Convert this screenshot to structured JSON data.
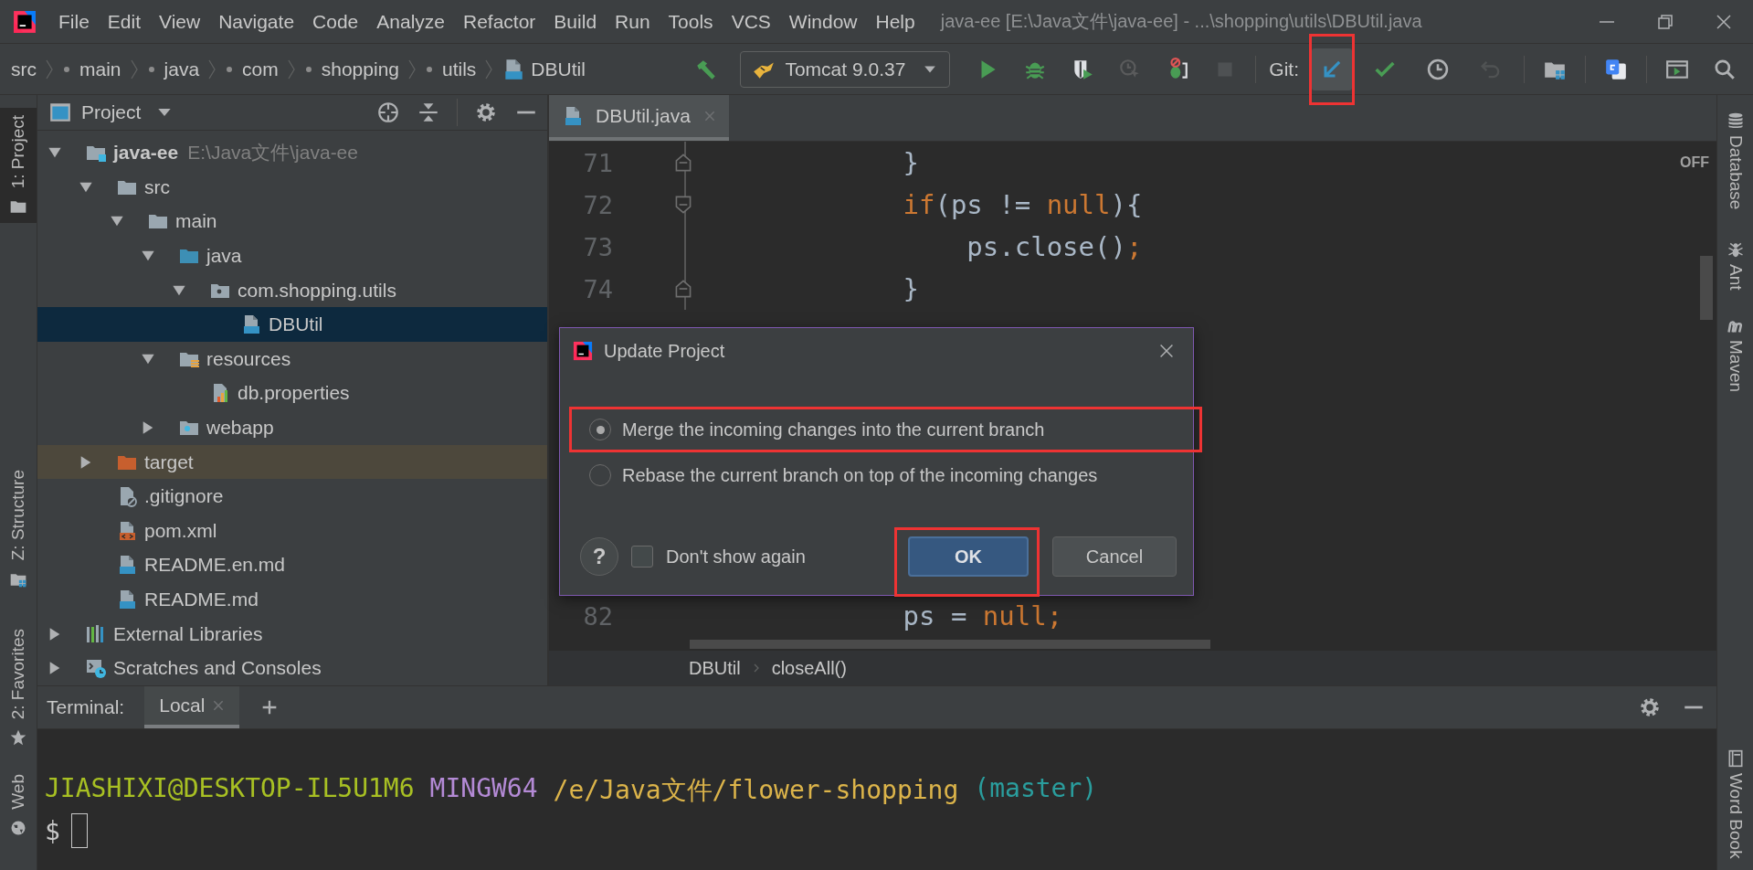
{
  "menu_bar": {
    "items": [
      "File",
      "Edit",
      "View",
      "Navigate",
      "Code",
      "Analyze",
      "Refactor",
      "Build",
      "Run",
      "Tools",
      "VCS",
      "Window",
      "Help"
    ],
    "title": "java-ee [E:\\Java文件\\java-ee] - ...\\shopping\\utils\\DBUtil.java"
  },
  "nav_bar": {
    "breadcrumb": [
      {
        "label": "src",
        "kind": "root"
      },
      {
        "label": "main",
        "kind": "package"
      },
      {
        "label": "java",
        "kind": "package"
      },
      {
        "label": "com",
        "kind": "package"
      },
      {
        "label": "shopping",
        "kind": "package"
      },
      {
        "label": "utils",
        "kind": "package"
      },
      {
        "label": "DBUtil",
        "kind": "class"
      }
    ],
    "run_config": "Tomcat 9.0.37",
    "run_tools": [
      {
        "kind": "run",
        "disabled": false
      },
      {
        "kind": "debug",
        "disabled": false
      },
      {
        "kind": "coverage",
        "disabled": false
      },
      {
        "kind": "profile",
        "disabled": true
      },
      {
        "kind": "attach",
        "disabled": false
      },
      {
        "kind": "stop",
        "disabled": true
      }
    ],
    "git_label": "Git:",
    "git_tools": [
      {
        "kind": "update",
        "disabled": false,
        "hovered": true,
        "annotated": true
      },
      {
        "kind": "commit",
        "disabled": false,
        "hovered": false,
        "annotated": false
      },
      {
        "kind": "history",
        "disabled": false,
        "hovered": false,
        "annotated": false
      },
      {
        "kind": "rollback",
        "disabled": true,
        "hovered": false,
        "annotated": false
      }
    ],
    "extra_tools": [
      {
        "kind": "structure"
      },
      {
        "kind": "translate"
      },
      {
        "kind": "run-window"
      },
      {
        "kind": "search"
      }
    ]
  },
  "left_tool_windows": [
    {
      "label": "1: Project",
      "kind": "project",
      "selected": true
    },
    {
      "label": "Z: Structure",
      "kind": "structure",
      "selected": false
    },
    {
      "label": "2: Favorites",
      "kind": "favorites",
      "selected": false
    },
    {
      "label": "Web",
      "kind": "web",
      "selected": false
    }
  ],
  "right_tool_windows": [
    {
      "label": "Database",
      "kind": "database"
    },
    {
      "label": "Ant",
      "kind": "ant"
    },
    {
      "label": "Maven",
      "kind": "maven"
    },
    {
      "label": "Word Book",
      "kind": "book"
    }
  ],
  "project_panel": {
    "title": "Project",
    "tree": [
      {
        "label": "java-ee",
        "hint": "E:\\Java文件\\java-ee",
        "kind": "module",
        "expanded": true,
        "selected": false,
        "children": [
          {
            "label": "src",
            "kind": "folder",
            "expanded": true,
            "selected": false,
            "children": [
              {
                "label": "main",
                "kind": "folder",
                "expanded": true,
                "selected": false,
                "children": [
                  {
                    "label": "java",
                    "kind": "source-root",
                    "expanded": true,
                    "selected": false,
                    "children": [
                      {
                        "label": "com.shopping.utils",
                        "kind": "package",
                        "expanded": true,
                        "selected": false,
                        "children": [
                          {
                            "label": "DBUtil",
                            "kind": "java-class",
                            "selected": true
                          }
                        ]
                      }
                    ]
                  },
                  {
                    "label": "resources",
                    "kind": "resource-root",
                    "expanded": true,
                    "selected": false,
                    "children": [
                      {
                        "label": "db.properties",
                        "kind": "properties",
                        "selected": false
                      }
                    ]
                  },
                  {
                    "label": "webapp",
                    "kind": "web-folder",
                    "expanded": false,
                    "selected": false
                  }
                ]
              }
            ]
          },
          {
            "label": "target",
            "kind": "excluded-folder",
            "expanded": false,
            "selected": false
          },
          {
            "label": ".gitignore",
            "kind": "gitignore",
            "selected": false
          },
          {
            "label": "pom.xml",
            "kind": "xml",
            "selected": false
          },
          {
            "label": "README.en.md",
            "kind": "markdown",
            "selected": false
          },
          {
            "label": "README.md",
            "kind": "markdown",
            "selected": false
          }
        ]
      },
      {
        "label": "External Libraries",
        "kind": "libraries",
        "expanded": false,
        "selected": false
      },
      {
        "label": "Scratches and Consoles",
        "kind": "scratches",
        "expanded": false,
        "selected": false
      }
    ]
  },
  "editor": {
    "tabs": [
      {
        "label": "DBUtil.java",
        "selected": true
      }
    ],
    "code_blocks": [
      [
        {
          "number": "71",
          "kind": "fold-end",
          "tokens": [
            {
              "text": "            }",
              "kind": "plain"
            }
          ]
        },
        {
          "number": "72",
          "kind": "fold-start",
          "tokens": [
            {
              "text": "            if",
              "kind": "keyword"
            },
            {
              "text": "(ps != ",
              "kind": "plain"
            },
            {
              "text": "null",
              "kind": "keyword"
            },
            {
              "text": "){",
              "kind": "plain"
            }
          ]
        },
        {
          "number": "73",
          "kind": "plain",
          "tokens": [
            {
              "text": "                ps.close()",
              "kind": "plain"
            },
            {
              "text": ";",
              "kind": "keyword"
            }
          ]
        },
        {
          "number": "74",
          "kind": "fold-end",
          "tokens": [
            {
              "text": "            }",
              "kind": "plain"
            }
          ]
        }
      ],
      [
        {
          "number": "82",
          "kind": "plain",
          "tokens": [
            {
              "text": "            ps = ",
              "kind": "plain"
            },
            {
              "text": "null;",
              "kind": "keyword"
            }
          ]
        }
      ]
    ],
    "inspection_label": "OFF",
    "breadcrumb": [
      "DBUtil",
      "closeAll()"
    ]
  },
  "dialog": {
    "title": "Update Project",
    "options": [
      {
        "label": "Merge the incoming changes into the current branch",
        "selected": true,
        "annotated": true
      },
      {
        "label": "Rebase the current branch on top of the incoming changes",
        "selected": false,
        "annotated": false
      }
    ],
    "help": "?",
    "checkbox": {
      "label": "Don't show again",
      "checked": false
    },
    "buttons": [
      {
        "label": "OK",
        "kind": "primary",
        "annotated": true
      },
      {
        "label": "Cancel",
        "kind": "secondary",
        "annotated": false
      }
    ]
  },
  "terminal": {
    "label": "Terminal:",
    "tabs": [
      {
        "label": "Local",
        "selected": true
      }
    ],
    "prompt": [
      {
        "text": "JIASHIXI@DESKTOP-IL5U1M6",
        "color": "#a8c023"
      },
      {
        "text": "MINGW64",
        "color": "#b48ad6"
      },
      {
        "text": "/e/Java文件/flower-shopping",
        "color": "#dcb44a"
      },
      {
        "text": "(master)",
        "color": "#2a9d9d"
      }
    ],
    "input_prompt": "$"
  }
}
